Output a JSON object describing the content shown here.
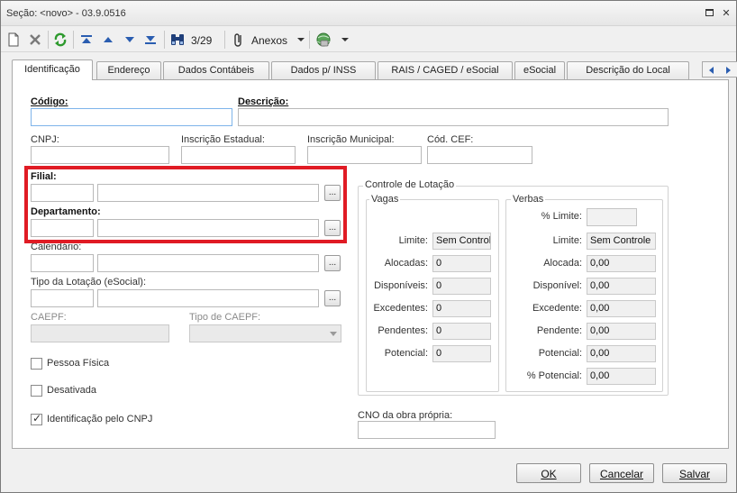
{
  "window": {
    "title": "Seção: <novo> - 03.9.0516"
  },
  "toolbar": {
    "record_counter": "3/29",
    "attachments_label": "Anexos"
  },
  "tabs": [
    {
      "label": "Identificação",
      "active": true
    },
    {
      "label": "Endereço"
    },
    {
      "label": "Dados Contábeis"
    },
    {
      "label": "Dados p/ INSS"
    },
    {
      "label": "RAIS / CAGED / eSocial"
    },
    {
      "label": "eSocial"
    },
    {
      "label": "Descrição do Local"
    }
  ],
  "form": {
    "codigo_label": "Código:",
    "descricao_label": "Descrição:",
    "cnpj_label": "CNPJ:",
    "insc_estadual_label": "Inscrição Estadual:",
    "insc_municipal_label": "Inscrição Municipal:",
    "cod_cef_label": "Cód. CEF:",
    "filial_label": "Filial:",
    "departamento_label": "Departamento:",
    "calendario_label": "Calendário:",
    "tipo_lotacao_label": "Tipo da Lotação (eSocial):",
    "caepf_label": "CAEPF:",
    "tipo_caepf_label": "Tipo de CAEPF:",
    "lookup_label": "...",
    "pessoa_fisica_label": "Pessoa Física",
    "desativada_label": "Desativada",
    "ident_cnpj_label": "Identificação pelo CNPJ",
    "cno_label": "CNO da obra própria:"
  },
  "controle": {
    "title": "Controle de Lotação",
    "vagas": {
      "title": "Vagas",
      "rows": [
        {
          "label": "Limite:",
          "value": "Sem Controle"
        },
        {
          "label": "Alocadas:",
          "value": "0"
        },
        {
          "label": "Disponíveis:",
          "value": "0"
        },
        {
          "label": "Excedentes:",
          "value": "0"
        },
        {
          "label": "Pendentes:",
          "value": "0"
        },
        {
          "label": "Potencial:",
          "value": "0"
        }
      ]
    },
    "verbas": {
      "title": "Verbas",
      "pct_limite_label": "% Limite:",
      "rows": [
        {
          "label": "Limite:",
          "value": "Sem Controle"
        },
        {
          "label": "Alocada:",
          "value": "0,00"
        },
        {
          "label": "Disponível:",
          "value": "0,00"
        },
        {
          "label": "Excedente:",
          "value": "0,00"
        },
        {
          "label": "Pendente:",
          "value": "0,00"
        },
        {
          "label": "Potencial:",
          "value": "0,00"
        },
        {
          "label": "% Potencial:",
          "value": "0,00"
        }
      ]
    }
  },
  "footer": {
    "ok_label": "OK",
    "cancel_label": "Cancelar",
    "save_label": "Salvar"
  },
  "colors": {
    "highlight": "#e01b24",
    "focus_border": "#7eb4ea"
  }
}
